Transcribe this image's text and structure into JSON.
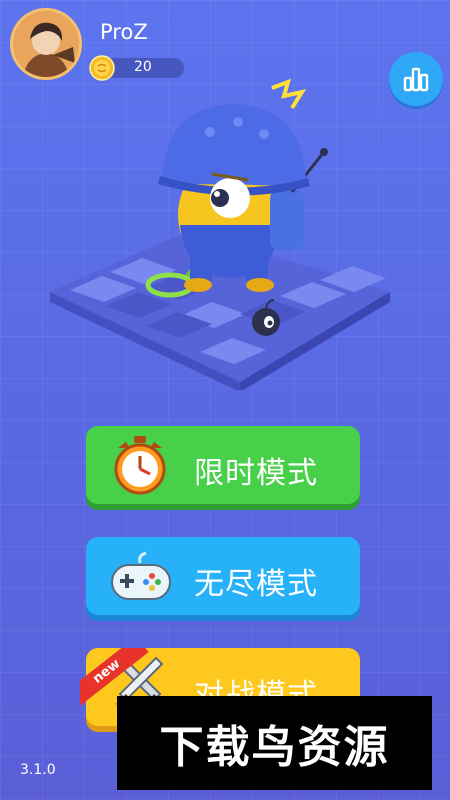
{
  "profile": {
    "username": "ProZ",
    "coins": "20"
  },
  "modes": [
    {
      "label": "限时模式",
      "icon": "stopwatch-icon"
    },
    {
      "label": "无尽模式",
      "icon": "gamepad-icon"
    },
    {
      "label": "对战模式",
      "icon": "crossed-swords-icon",
      "badge": "new"
    }
  ],
  "version": "3.1.0",
  "watermark": "下载鸟资源",
  "colors": {
    "background": "#5a6fe6",
    "timed": "#48d04a",
    "endless": "#26b1f8",
    "battle": "#ffc81f",
    "leaderboard": "#2ea8f6"
  },
  "icons": {
    "leaderboard": "bar-chart-icon",
    "coin": "coin-icon"
  }
}
